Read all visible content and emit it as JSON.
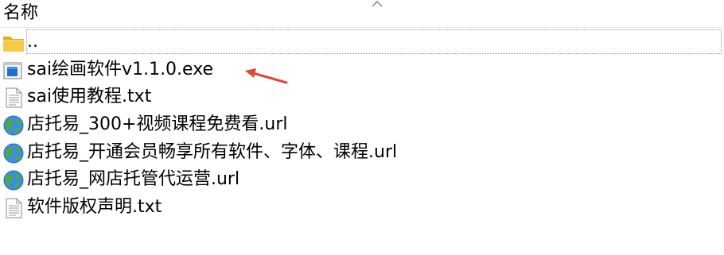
{
  "header": {
    "name_column": "名称",
    "sort_icon": "chevron-up-icon"
  },
  "files": [
    {
      "name": "..",
      "icon": "folder-icon"
    },
    {
      "name": "sai绘画软件v1.1.0.exe",
      "icon": "exe-icon"
    },
    {
      "name": "sai使用教程.txt",
      "icon": "text-file-icon"
    },
    {
      "name": "店托易_300+视频课程免费看.url",
      "icon": "globe-icon"
    },
    {
      "name": "店托易_开通会员畅享所有软件、字体、课程.url",
      "icon": "globe-icon"
    },
    {
      "name": "店托易_网店托管代运营.url",
      "icon": "globe-icon"
    },
    {
      "name": "软件版权声明.txt",
      "icon": "text-file-icon"
    }
  ],
  "annotation": {
    "icon": "arrow-icon",
    "color": "#e0463a"
  }
}
